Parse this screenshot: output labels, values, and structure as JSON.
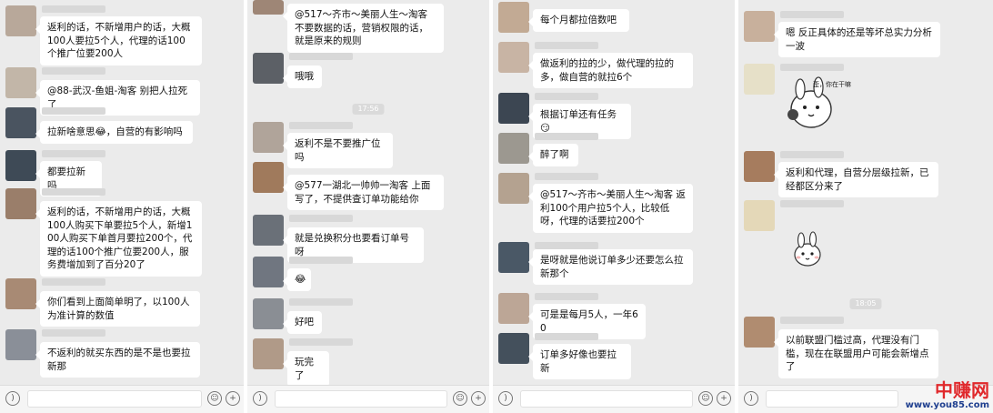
{
  "panels": [
    {
      "messages": [
        {
          "text": "返利的话，不新增用户的话，大概100人要拉5个人，代理的话100个推广位要200人",
          "avatar_color": "#b8a89a"
        },
        {
          "text": "@88-武汉-鱼姐-淘客 别把人拉死了",
          "avatar_color": "#c2b6a8"
        },
        {
          "text": "拉新啥意思😂，自营的有影响吗",
          "avatar_color": "#4a5460"
        },
        {
          "text": "都要拉新吗",
          "avatar_color": "#3e4a56"
        },
        {
          "text": "返利的话，不新增用户的话，大概100人购买下单要拉5个人，新增100人购买下单首月要拉200个，代理的话100个推广位要200人，服务费增加到了百分20了",
          "avatar_color": "#9a7e6a"
        },
        {
          "text": "你们看到上面简单明了，以100人为准计算的数值",
          "avatar_color": "#a88a74"
        },
        {
          "text": "不返利的就买东西的是不是也要拉新那",
          "avatar_color": "#8a8f98"
        }
      ]
    },
    {
      "messages": [
        {
          "text": "@517～齐市～美丽人生～淘客 不要数据的话，营销权限的话，就是原来的规则",
          "avatar_color": "#9e8676"
        },
        {
          "text": "哦哦",
          "avatar_color": "#5c6066"
        },
        {
          "text": "返利不是不要推广位吗",
          "avatar_color": "#b0a49a"
        },
        {
          "text": "@577一湖北一帅帅一淘客 上面写了，不提供查订单功能给你",
          "avatar_color": "#a07a5c"
        },
        {
          "text": "就是兑换积分也要看订单号呀",
          "avatar_color": "#6a7078"
        },
        {
          "text": "😂",
          "avatar_color": "#707680"
        },
        {
          "text": "好吧",
          "avatar_color": "#8a8e94"
        },
        {
          "text": "玩完了",
          "avatar_color": "#b09a88"
        }
      ],
      "time": "17:56"
    },
    {
      "messages": [
        {
          "text": "每个月都拉倍数吧",
          "avatar_color": "#c2aa94"
        },
        {
          "text": "做返利的拉的少，做代理的拉的多，做自营的就拉6个",
          "avatar_color": "#c8b4a4"
        },
        {
          "text": "根据订单还有任务😏",
          "avatar_color": "#3c4652"
        },
        {
          "text": "醉了啊",
          "avatar_color": "#9c9890"
        },
        {
          "text": "@517～齐市～美丽人生～淘客 返利100个用户拉5个人，比较低呀，代理的话要拉200个",
          "avatar_color": "#b4a290"
        },
        {
          "text": "是呀就是他说订单多少还要怎么拉新那个",
          "avatar_color": "#4a5866"
        },
        {
          "text": "可是是每月5人，一年60",
          "avatar_color": "#bca696"
        },
        {
          "text": "订单多好像也要拉新",
          "avatar_color": "#44505c"
        }
      ]
    },
    {
      "messages": [
        {
          "text": "嗯 反正具体的还是等坏总实力分析一波",
          "avatar_color": "#c8b09c"
        },
        {
          "text": "返利和代理，自营分层级拉新，已经都区分来了",
          "avatar_color": "#a67c5e"
        },
        {
          "text": "以前联盟门槛过高，代理没有门槛，现在在联盟用户可能会新增点了",
          "avatar_color": "#b08c70"
        }
      ],
      "time": "18:05",
      "sticker_text": "歪，你在干嘛"
    }
  ],
  "input_bar": {
    "voice_icon": "voice-icon",
    "emoji_icon": "emoji-icon",
    "plus_icon": "plus-icon"
  },
  "watermark": {
    "main": "中赚网",
    "url": "www.you85.com"
  }
}
